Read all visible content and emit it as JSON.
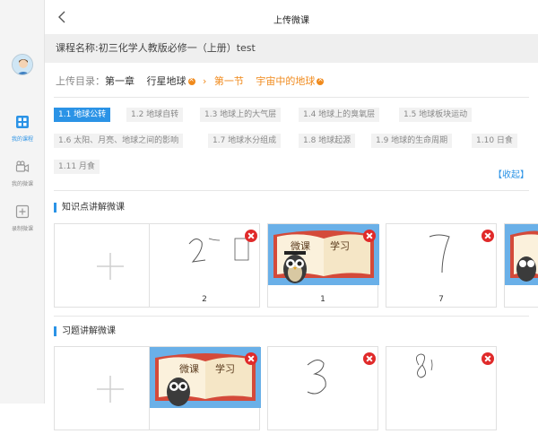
{
  "header": {
    "title": "上传微课"
  },
  "course": {
    "label": "课程名称:初三化学人教版必修一（上册）test"
  },
  "directory": {
    "label": "上传目录：",
    "chapter": "第一章",
    "chapter_name": "行星地球",
    "section": "第一节",
    "section_name": "宇宙中的地球"
  },
  "sidebar": {
    "items": [
      {
        "label": "我的课程",
        "icon": "grid-icon",
        "active": true
      },
      {
        "label": "我的微课",
        "icon": "video-camera-icon",
        "active": false
      },
      {
        "label": "录制微课",
        "icon": "plus-square-icon",
        "active": false
      }
    ]
  },
  "topics": [
    "1.1 地球公转",
    "1.2 地球自转",
    "1.3 地球上的大气层",
    "1.4 地球上的臭氧层",
    "1.5 地球板块运动",
    "1.6 太阳、月亮、地球之间的影响",
    "1.7 地球水分组成",
    "1.8 地球起源",
    "1.9 地球的生命周期",
    "1.10 日食",
    "1.11 月食"
  ],
  "collapse_label": "【收起】",
  "sections": {
    "knowledge": {
      "title": "知识点讲解微课",
      "cards": [
        "2",
        "1",
        "7"
      ]
    },
    "exercise": {
      "title": "习题讲解微课"
    }
  },
  "thumb": {
    "text1": "微课",
    "text2": "学习"
  },
  "colors": {
    "accent": "#2b93e6",
    "orange": "#f08a1c",
    "delete": "#e02a2a"
  }
}
